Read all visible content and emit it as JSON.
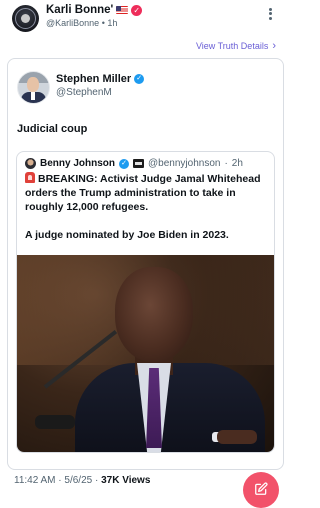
{
  "author": {
    "name": "Karli Bonne'",
    "handle": "@KarliBonne",
    "time": "1h"
  },
  "view_link": "View Truth Details",
  "post": {
    "name": "Stephen Miller",
    "handle": "@StephenM",
    "text": "Judicial coup"
  },
  "quote": {
    "name": "Benny Johnson",
    "handle": "@bennyjohnson",
    "time": "2h",
    "line1": "BREAKING: Activist Judge Jamal Whitehead orders the Trump administration to take in roughly 12,000 refugees.",
    "line2": "A judge nominated by Joe Biden in 2023."
  },
  "meta": {
    "time": "11:42 AM",
    "date": "5/6/25",
    "views_count": "37K Views"
  },
  "colors": {
    "accent_link": "#6a5fd6",
    "fab": "#f2526a",
    "verified": "#1d9bf0"
  }
}
